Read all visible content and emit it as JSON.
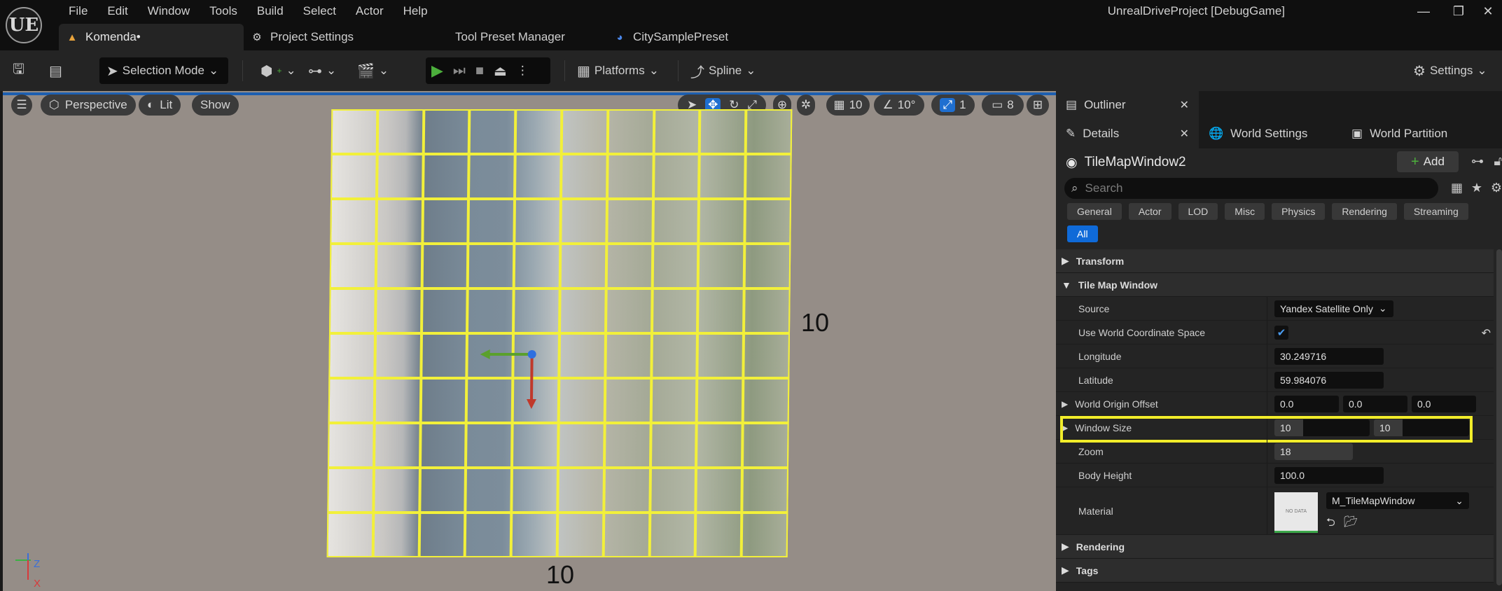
{
  "titlebar": {
    "logo": "UE",
    "menu": [
      "File",
      "Edit",
      "Window",
      "Tools",
      "Build",
      "Select",
      "Actor",
      "Help"
    ],
    "window_title": "UnrealDriveProject [DebugGame]",
    "tabs": [
      {
        "label": "Komenda•",
        "icon": "level-icon"
      },
      {
        "label": "Project Settings",
        "icon": "settings-icon"
      },
      {
        "label": "Tool Preset Manager",
        "icon": ""
      },
      {
        "label": "CitySamplePreset",
        "icon": "preset-icon"
      }
    ]
  },
  "toolbar": {
    "selection_mode": "Selection Mode",
    "platforms": "Platforms",
    "spline": "Spline",
    "settings": "Settings"
  },
  "viewport": {
    "perspective": "Perspective",
    "lit": "Lit",
    "show": "Show",
    "grid_snap": "10",
    "rotation_snap": "10°",
    "scale_snap": "1",
    "camera_speed": "8",
    "grid_cols": 10,
    "grid_rows": 10,
    "width_label": "10",
    "height_label": "10",
    "axis_labels": {
      "z": "Z",
      "x": "X"
    }
  },
  "panels": {
    "outliner": "Outliner",
    "details": "Details",
    "world_settings": "World Settings",
    "world_partition": "World Partition",
    "actor_name": "TileMapWindow2",
    "add_label": "Add",
    "search_placeholder": "Search",
    "filters": [
      "General",
      "Actor",
      "LOD",
      "Misc",
      "Physics",
      "Rendering",
      "Streaming",
      "All"
    ],
    "active_filter": "All",
    "categories": {
      "transform": "Transform",
      "tile_map_window": "Tile Map Window",
      "rendering": "Rendering",
      "tags": "Tags"
    },
    "props": {
      "source": {
        "label": "Source",
        "value": "Yandex Satellite Only"
      },
      "use_world_coord": {
        "label": "Use World Coordinate Space",
        "checked": true
      },
      "longitude": {
        "label": "Longitude",
        "value": "30.249716"
      },
      "latitude": {
        "label": "Latitude",
        "value": "59.984076"
      },
      "world_origin_offset": {
        "label": "World Origin Offset",
        "x": "0.0",
        "y": "0.0",
        "z": "0.0"
      },
      "window_size": {
        "label": "Window Size",
        "x": "10",
        "y": "10"
      },
      "zoom": {
        "label": "Zoom",
        "value": "18"
      },
      "body_height": {
        "label": "Body Height",
        "value": "100.0"
      },
      "material": {
        "label": "Material",
        "value": "M_TileMapWindow",
        "thumb": "NO DATA"
      }
    }
  },
  "colors": {
    "highlight": "#f1ec2a",
    "grid": "#f2f03a",
    "accent_blue": "#0f6ad8",
    "play_green": "#4caf3c"
  }
}
